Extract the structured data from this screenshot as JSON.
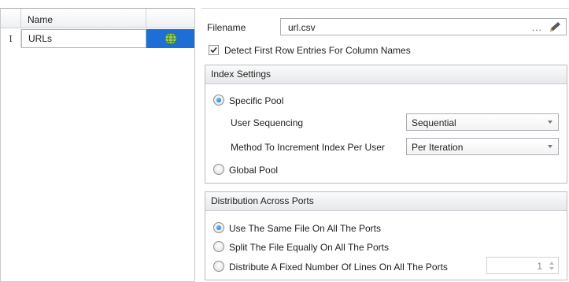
{
  "grid": {
    "column_name": "Name",
    "rows": [
      {
        "indicator": "I",
        "name": "URLs",
        "icon": "globe-icon"
      }
    ]
  },
  "file": {
    "label": "Filename",
    "value": "url.csv",
    "browse": "...",
    "edit_icon": "pencil-icon"
  },
  "detect_header": {
    "label": "Detect First Row Entries For Column Names",
    "checked": true
  },
  "index_settings": {
    "title": "Index Settings",
    "specific_pool": "Specific Pool",
    "user_sequencing_label": "User Sequencing",
    "user_sequencing_value": "Sequential",
    "increment_label": "Method To Increment Index Per User",
    "increment_value": "Per Iteration",
    "global_pool": "Global Pool"
  },
  "distribution": {
    "title": "Distribution Across Ports",
    "same_file": "Use The Same File On All The Ports",
    "split_file": "Split The File Equally On All The Ports",
    "fixed_lines": "Distribute A Fixed Number Of Lines On All The Ports",
    "fixed_lines_value": "1"
  },
  "colors": {
    "selection": "#1d6fd6",
    "radio_dot": "#1565c0"
  }
}
